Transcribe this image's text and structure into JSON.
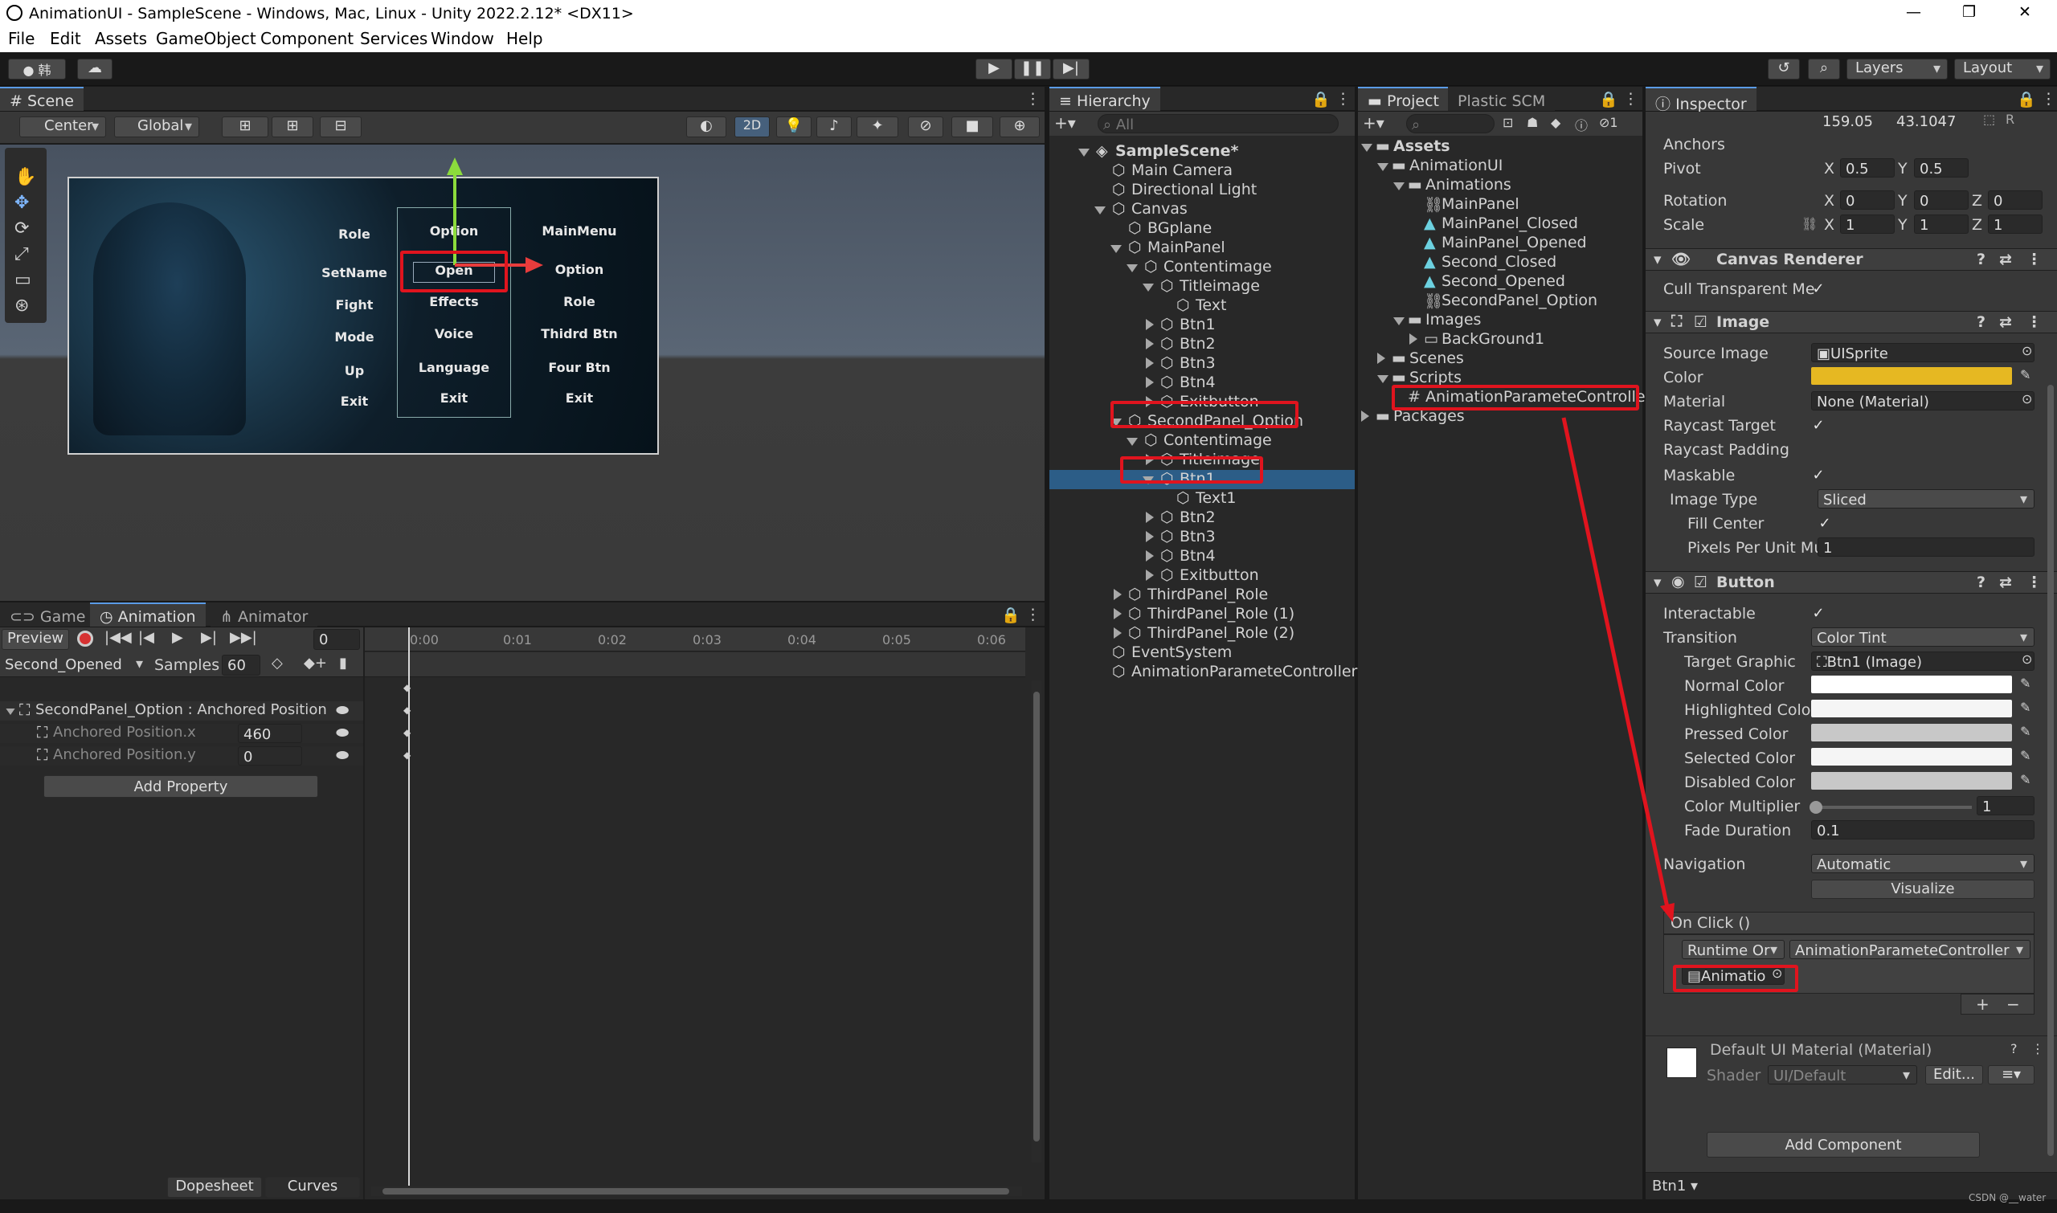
{
  "window": {
    "title": "AnimationUI - SampleScene - Windows, Mac, Linux - Unity 2022.2.12* <DX11>",
    "min": "—",
    "max": "❐",
    "close": "✕"
  },
  "menu": [
    "File",
    "Edit",
    "Assets",
    "GameObject",
    "Component",
    "Services",
    "Window",
    "Help"
  ],
  "toolbar": {
    "account": "韩",
    "layers": "Layers",
    "layout": "Layout"
  },
  "scene": {
    "tab": "Scene",
    "pivot": "Center",
    "space": "Global",
    "mode2d": "2D",
    "ui_left": [
      "Role",
      "SetName",
      "Fight",
      "Mode",
      "Up",
      "Exit"
    ],
    "ui_mid": [
      "Option",
      "Open",
      "Effects",
      "Voice",
      "Language",
      "Exit"
    ],
    "ui_right": [
      "MainMenu",
      "Option",
      "Role",
      "Thidrd Btn",
      "Four Btn",
      "Exit"
    ]
  },
  "bottom": {
    "tabs": [
      "Game",
      "Animation",
      "Animator"
    ],
    "preview": "Preview",
    "frame": "0",
    "clip": "Second_Opened",
    "samples_label": "Samples",
    "samples": "60",
    "ticks": [
      "0:00",
      "0:01",
      "0:02",
      "0:03",
      "0:04",
      "0:05",
      "0:06"
    ],
    "prop_group": "SecondPanel_Option : Anchored Position",
    "props": [
      {
        "name": "Anchored Position.x",
        "value": "460"
      },
      {
        "name": "Anchored Position.y",
        "value": "0"
      }
    ],
    "add_property": "Add Property",
    "dopesheet": "Dopesheet",
    "curves": "Curves"
  },
  "hierarchy": {
    "tab": "Hierarchy",
    "search": "All",
    "items": [
      {
        "name": "SampleScene*",
        "depth": 0,
        "scene": true,
        "open": true
      },
      {
        "name": "Main Camera",
        "depth": 1
      },
      {
        "name": "Directional Light",
        "depth": 1
      },
      {
        "name": "Canvas",
        "depth": 1,
        "open": true
      },
      {
        "name": "BGplane",
        "depth": 2
      },
      {
        "name": "MainPanel",
        "depth": 2,
        "open": true
      },
      {
        "name": "Contentimage",
        "depth": 3,
        "open": true
      },
      {
        "name": "Titleimage",
        "depth": 4,
        "open": true
      },
      {
        "name": "Text",
        "depth": 5
      },
      {
        "name": "Btn1",
        "depth": 4,
        "closed": true
      },
      {
        "name": "Btn2",
        "depth": 4,
        "closed": true
      },
      {
        "name": "Btn3",
        "depth": 4,
        "closed": true
      },
      {
        "name": "Btn4",
        "depth": 4,
        "closed": true
      },
      {
        "name": "Exitbutton",
        "depth": 4,
        "closed": true
      },
      {
        "name": "SecondPanel_Option",
        "depth": 2,
        "open": true
      },
      {
        "name": "Contentimage",
        "depth": 3,
        "open": true
      },
      {
        "name": "Titleimage",
        "depth": 4,
        "closed": true
      },
      {
        "name": "Btn1",
        "depth": 4,
        "open": true,
        "selected": true
      },
      {
        "name": "Text1",
        "depth": 5
      },
      {
        "name": "Btn2",
        "depth": 4,
        "closed": true
      },
      {
        "name": "Btn3",
        "depth": 4,
        "closed": true
      },
      {
        "name": "Btn4",
        "depth": 4,
        "closed": true
      },
      {
        "name": "Exitbutton",
        "depth": 4,
        "closed": true
      },
      {
        "name": "ThirdPanel_Role",
        "depth": 2,
        "closed": true
      },
      {
        "name": "ThirdPanel_Role (1)",
        "depth": 2,
        "closed": true
      },
      {
        "name": "ThirdPanel_Role (2)",
        "depth": 2,
        "closed": true
      },
      {
        "name": "EventSystem",
        "depth": 1
      },
      {
        "name": "AnimationParameteController",
        "depth": 1
      }
    ]
  },
  "project": {
    "tabs": [
      "Project",
      "Plastic SCM"
    ],
    "items": [
      {
        "name": "Assets",
        "depth": 0,
        "open": true,
        "folder": true,
        "bold": true
      },
      {
        "name": "AnimationUI",
        "depth": 1,
        "open": true,
        "folder": true
      },
      {
        "name": "Animations",
        "depth": 2,
        "open": true,
        "folder": true
      },
      {
        "name": "MainPanel",
        "depth": 3,
        "type": "ctrl"
      },
      {
        "name": "MainPanel_Closed",
        "depth": 3,
        "type": "anim"
      },
      {
        "name": "MainPanel_Opened",
        "depth": 3,
        "type": "anim"
      },
      {
        "name": "Second_Closed",
        "depth": 3,
        "type": "anim"
      },
      {
        "name": "Second_Opened",
        "depth": 3,
        "type": "anim"
      },
      {
        "name": "SecondPanel_Option",
        "depth": 3,
        "type": "ctrl"
      },
      {
        "name": "Images",
        "depth": 2,
        "open": true,
        "folder": true
      },
      {
        "name": "BackGround1",
        "depth": 3,
        "type": "img",
        "closed": true
      },
      {
        "name": "Scenes",
        "depth": 1,
        "folder": true,
        "closed": true
      },
      {
        "name": "Scripts",
        "depth": 1,
        "folder": true,
        "open": true
      },
      {
        "name": "AnimationParameteController",
        "depth": 2,
        "type": "script"
      },
      {
        "name": "Packages",
        "depth": 0,
        "folder": true,
        "closed": true
      }
    ]
  },
  "inspector": {
    "tab": "Inspector",
    "size_w": "159.05",
    "size_h": "43.1047",
    "anchors": "Anchors",
    "pivot": "Pivot",
    "pivot_x": "0.5",
    "pivot_y": "0.5",
    "rotation": "Rotation",
    "rot": [
      "0",
      "0",
      "0"
    ],
    "scale": "Scale",
    "scl": [
      "1",
      "1",
      "1"
    ],
    "canvas_renderer": "Canvas Renderer",
    "cull": "Cull Transparent Me",
    "image": "Image",
    "source_image": "Source Image",
    "source_val": "UISprite",
    "color": "Color",
    "color_val": "#e6b822",
    "material": "Material",
    "material_val": "None (Material)",
    "raycast_target": "Raycast Target",
    "raycast_padding": "Raycast Padding",
    "maskable": "Maskable",
    "image_type": "Image Type",
    "image_type_val": "Sliced",
    "fill_center": "Fill Center",
    "ppu": "Pixels Per Unit Mu",
    "ppu_val": "1",
    "button": "Button",
    "interactable": "Interactable",
    "transition": "Transition",
    "transition_val": "Color Tint",
    "target_graphic": "Target Graphic",
    "target_val": "Btn1 (Image)",
    "colors": [
      {
        "label": "Normal Color",
        "hex": "#ffffff"
      },
      {
        "label": "Highlighted Color",
        "hex": "#f5f5f5"
      },
      {
        "label": "Pressed Color",
        "hex": "#c8c8c8"
      },
      {
        "label": "Selected Color",
        "hex": "#f5f5f5"
      },
      {
        "label": "Disabled Color",
        "hex": "#c8c8c8"
      }
    ],
    "color_mult": "Color Multiplier",
    "color_mult_val": "1",
    "fade": "Fade Duration",
    "fade_val": "0.1",
    "navigation": "Navigation",
    "navigation_val": "Automatic",
    "visualize": "Visualize",
    "onclick": "On Click ()",
    "runtime": "Runtime Or",
    "func": "AnimationParameteController",
    "obj": "Animatio",
    "mat_name": "Default UI Material (Material)",
    "shader": "Shader",
    "shader_val": "UI/Default",
    "edit": "Edit...",
    "add_component": "Add Component",
    "footer": "Btn1",
    "watermark": "CSDN @__water"
  }
}
